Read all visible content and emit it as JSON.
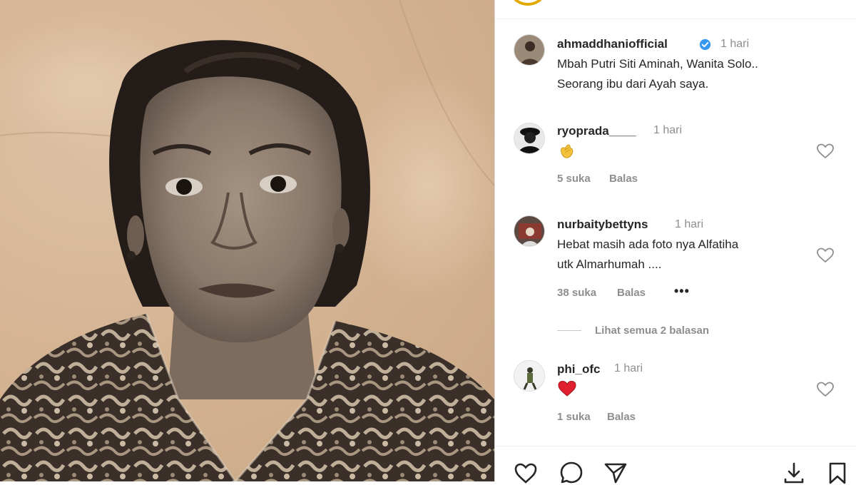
{
  "post": {
    "author": "ahmaddhaniofficial",
    "time": "1 hari",
    "caption_line1": "Mbah Putri Siti Aminah, Wanita Solo..",
    "caption_line2": "Seorang ibu dari Ayah saya."
  },
  "comments": [
    {
      "user": "ryoprada____",
      "time": "1 hari",
      "emoji": "clapping-hands",
      "likes": "5 suka",
      "reply": "Balas"
    },
    {
      "user": "nurbaitybettyns",
      "time": "1 hari",
      "text_line1": "Hebat masih ada foto nya Alfatiha",
      "text_line2": "utk Almarhumah ....",
      "likes": "38 suka",
      "reply": "Balas",
      "more": "•••",
      "view_replies": "Lihat semua 2 balasan"
    },
    {
      "user": "phi_ofc",
      "time": "1 hari",
      "emoji": "red-heart",
      "likes": "1 suka",
      "reply": "Balas"
    }
  ],
  "icons": {
    "verified": "verified-badge-icon",
    "like": "heart-outline-icon",
    "comment": "comment-bubble-icon",
    "share": "paper-plane-icon",
    "download": "download-icon",
    "save": "bookmark-icon"
  },
  "colors": {
    "verified": "#3897f0",
    "muted": "#8e8e8e",
    "text": "#262626",
    "heart_red": "#ed4956"
  }
}
